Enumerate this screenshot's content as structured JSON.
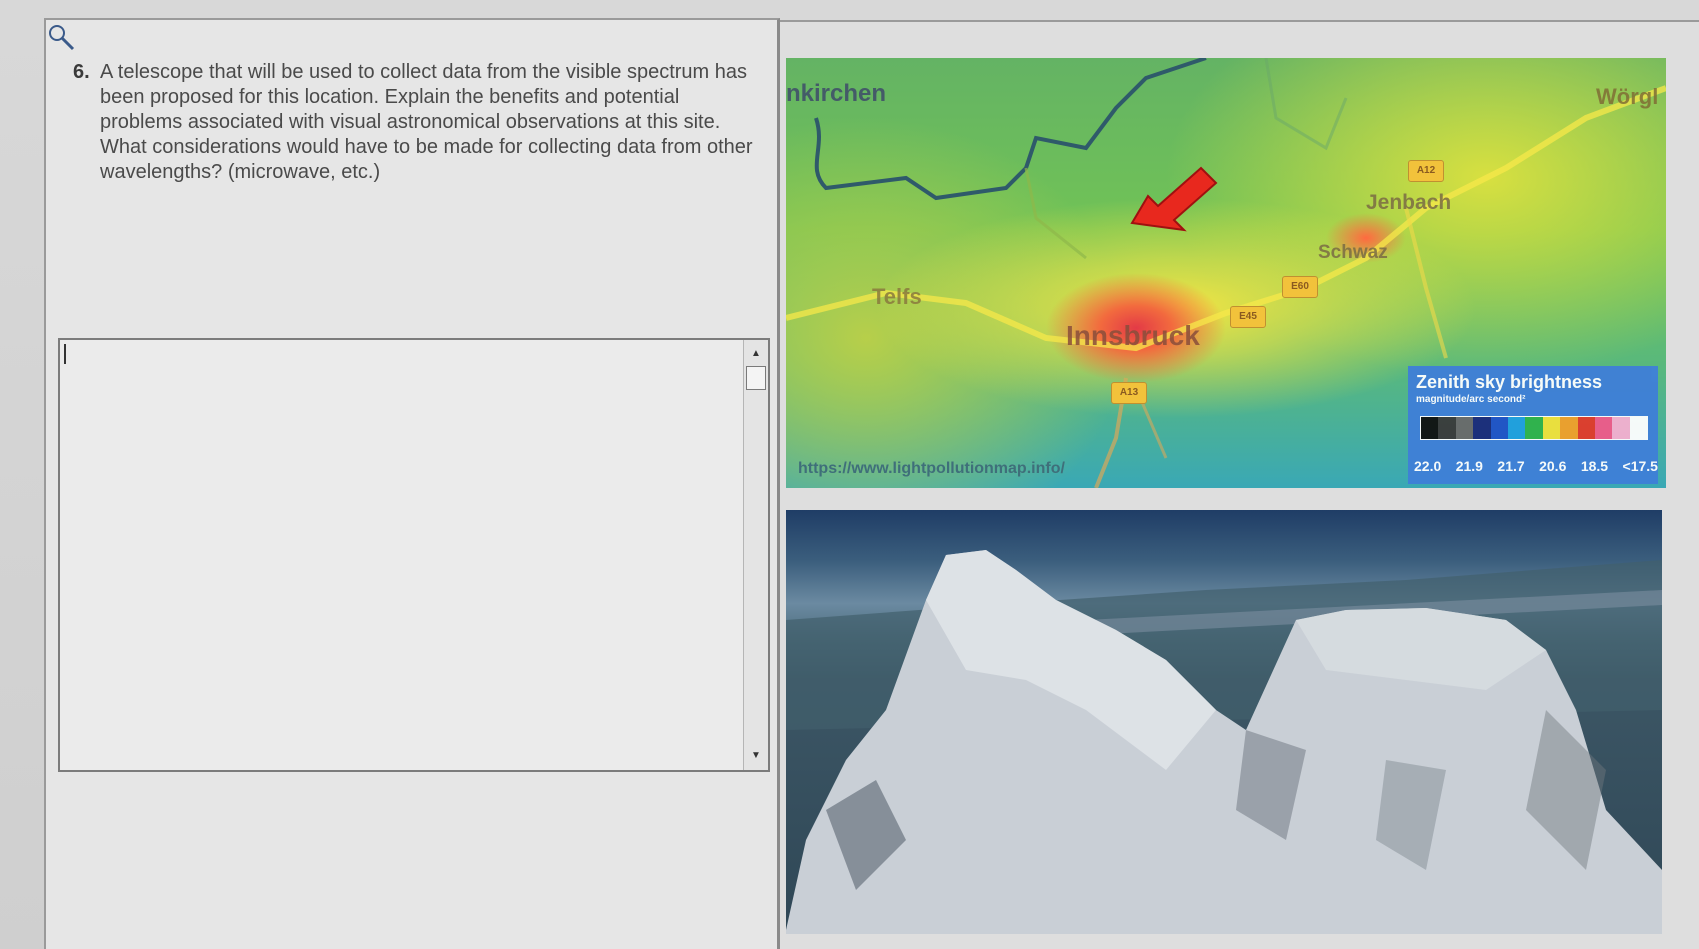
{
  "question": {
    "number": "6.",
    "text": "A telescope that will be used to collect data from the visible spectrum has been proposed for this location. Explain the benefits and potential problems associated with visual astronomical observations at this site. What considerations would have to be made for collecting data from other wavelengths? (microwave, etc.)"
  },
  "answer": {
    "value": ""
  },
  "map": {
    "labels": {
      "neukirchen": "nkirchen",
      "worgl": "Wörgl",
      "jenbach": "Jenbach",
      "schwaz": "Schwaz",
      "telfs": "Telfs",
      "innsbruck": "Innsbruck"
    },
    "shields": [
      "A12",
      "E45",
      "E60",
      "A13"
    ],
    "url": "https://www.lightpollutionmap.info/",
    "legend": {
      "title": "Zenith sky brightness",
      "subtitle": "magnitude/arc second²",
      "colors": [
        "#101010",
        "#3a3a3a",
        "#6a6a6a",
        "#1a2a7a",
        "#1f52c8",
        "#1fa0e0",
        "#2fb34a",
        "#f2e23a",
        "#f2a02a",
        "#e23a2a",
        "#f05a8a",
        "#f5b0d0",
        "#ffffff"
      ],
      "values": [
        "22.0",
        "21.9",
        "21.7",
        "20.6",
        "18.5",
        "<17.5"
      ]
    }
  }
}
